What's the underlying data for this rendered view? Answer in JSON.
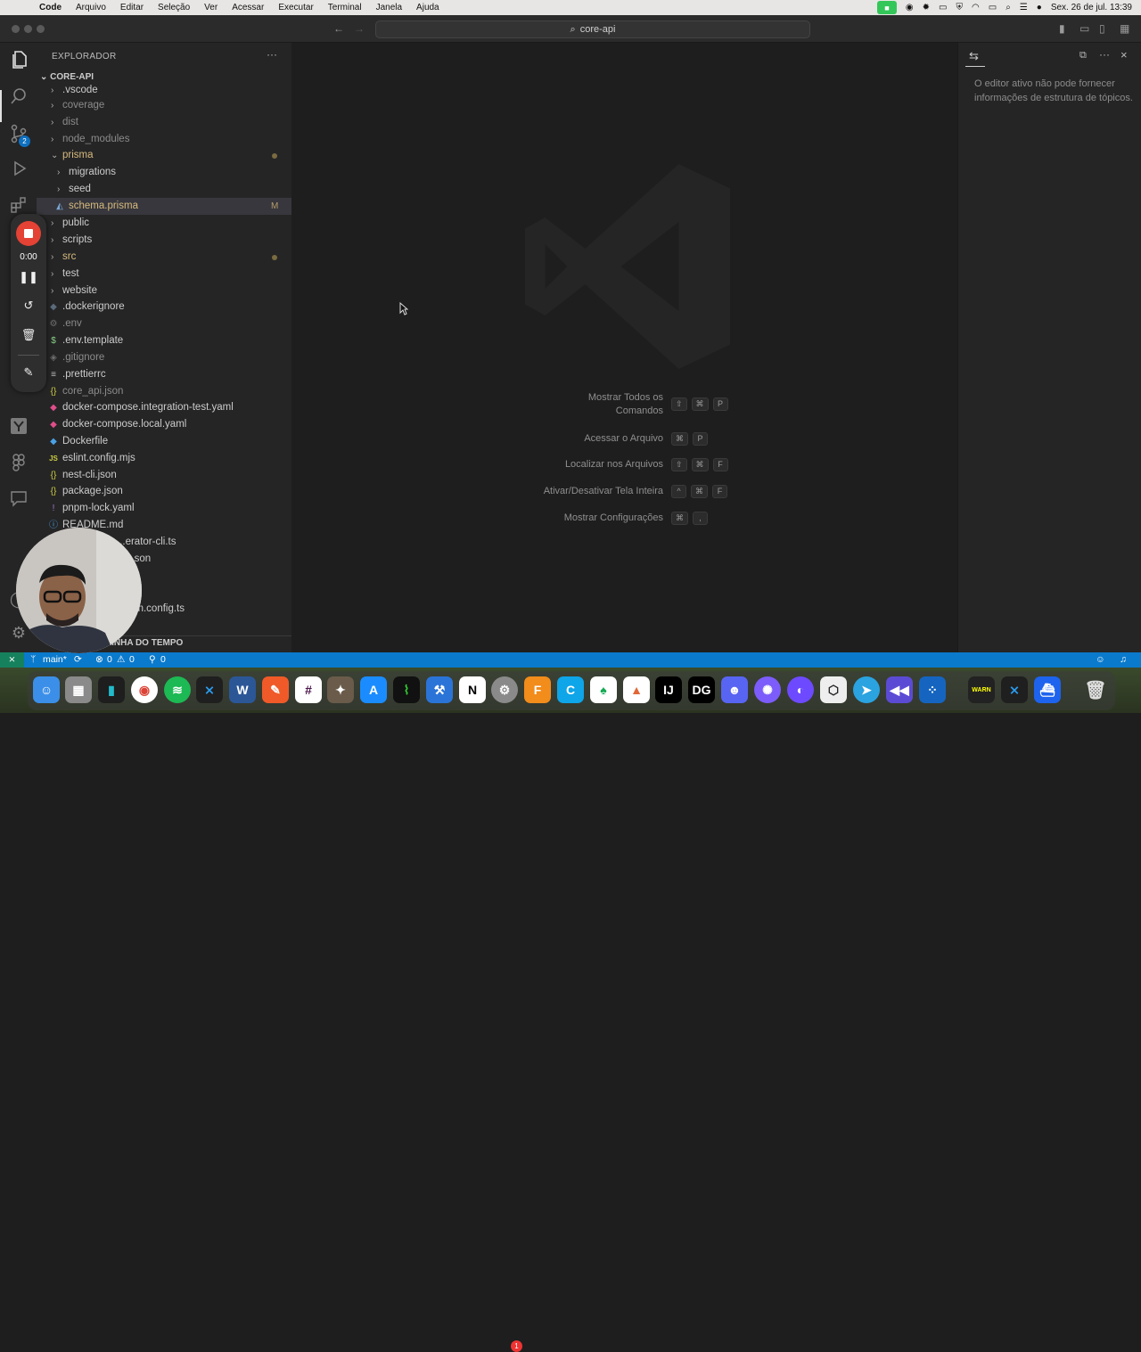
{
  "menubar": {
    "app": "Code",
    "items": [
      "Arquivo",
      "Editar",
      "Seleção",
      "Ver",
      "Acessar",
      "Executar",
      "Terminal",
      "Janela",
      "Ajuda"
    ],
    "datetime": "Sex. 26 de jul.  13:39"
  },
  "titlebar": {
    "search_text": "core-api"
  },
  "sidebar": {
    "title": "EXPLORADOR",
    "more": "···",
    "root": "CORE-API",
    "footer": "LINHA DO TEMPO",
    "rows": [
      {
        "label": ".vscode",
        "kind": "folder"
      },
      {
        "label": "coverage",
        "kind": "folder"
      },
      {
        "label": "dist",
        "kind": "folder"
      },
      {
        "label": "node_modules",
        "kind": "folder"
      },
      {
        "label": "prisma",
        "kind": "folder-open",
        "modified": true
      },
      {
        "label": "migrations",
        "kind": "subfolder"
      },
      {
        "label": "seed",
        "kind": "subfolder"
      },
      {
        "label": "schema.prisma",
        "kind": "file",
        "status": "M"
      },
      {
        "label": "public",
        "kind": "folder"
      },
      {
        "label": "scripts",
        "kind": "folder"
      },
      {
        "label": "src",
        "kind": "folder",
        "modified": true
      },
      {
        "label": "test",
        "kind": "folder"
      },
      {
        "label": "website",
        "kind": "folder"
      },
      {
        "label": ".dockerignore",
        "kind": "file"
      },
      {
        "label": ".env",
        "kind": "file"
      },
      {
        "label": ".env.template",
        "kind": "file"
      },
      {
        "label": ".gitignore",
        "kind": "file"
      },
      {
        "label": ".prettierrc",
        "kind": "file"
      },
      {
        "label": "core_api.json",
        "kind": "file"
      },
      {
        "label": "docker-compose.integration-test.yaml",
        "kind": "file"
      },
      {
        "label": "docker-compose.local.yaml",
        "kind": "file"
      },
      {
        "label": "Dockerfile",
        "kind": "file"
      },
      {
        "label": "eslint.config.mjs",
        "kind": "file"
      },
      {
        "label": "nest-cli.json",
        "kind": "file"
      },
      {
        "label": "package.json",
        "kind": "file"
      },
      {
        "label": "pnpm-lock.yaml",
        "kind": "file"
      },
      {
        "label": "README.md",
        "kind": "file"
      },
      {
        "label": "...erator-cli.ts",
        "kind": "file"
      },
      {
        "label": "...son",
        "kind": "file"
      },
      {
        "label": "",
        "kind": "file"
      },
      {
        "label": "...n.config.ts",
        "kind": "file"
      }
    ],
    "icons": {
      "dockerignore": "docker-icon",
      "env": "gear-icon",
      "json": "{}",
      "js": "JS",
      "yaml": "!",
      "md": "info-icon"
    }
  },
  "editor": {
    "shortcuts": [
      {
        "label": "Mostrar Todos os Comandos",
        "label_l1": "Mostrar Todos os",
        "label_l2": "Comandos",
        "keys": [
          "⇧",
          "⌘",
          "P"
        ]
      },
      {
        "label": "Acessar o Arquivo",
        "keys": [
          "⌘",
          "P"
        ]
      },
      {
        "label": "Localizar nos Arquivos",
        "keys": [
          "⇧",
          "⌘",
          "F"
        ]
      },
      {
        "label": "Ativar/Desativar Tela Inteira",
        "keys": [
          "^",
          "⌘",
          "F"
        ]
      },
      {
        "label": "Mostrar Configurações",
        "keys": [
          "⌘",
          ","
        ]
      }
    ]
  },
  "outline": {
    "message": "O editor ativo não pode fornecer informações de estrutura de tópicos."
  },
  "statusbar": {
    "branch": "main*",
    "errors": "0",
    "warnings": "0",
    "ports": "0"
  },
  "activitybar": {
    "scm_badge": "2"
  },
  "recorder": {
    "time": "0:00"
  },
  "dock": {
    "apps": [
      "Finder",
      "Launchpad",
      "Photos",
      "Chrome",
      "Spotify",
      "VS Code",
      "Word",
      "Pencil",
      "Slack",
      "GIMP",
      "App Store",
      "Activity Monitor",
      "Xcode Tools",
      "Notion",
      "System Settings",
      "Fusion 360",
      "Cursor",
      "MongoDB",
      "MATLAB",
      "IntelliJ IDEA",
      "DataGrip",
      "Discord",
      "Settings",
      "Proton",
      "Unity",
      "Telegram",
      "Rewind",
      "Network",
      "Console",
      "VS Code",
      "Docker",
      "Trash"
    ],
    "settings_badge": "1"
  }
}
